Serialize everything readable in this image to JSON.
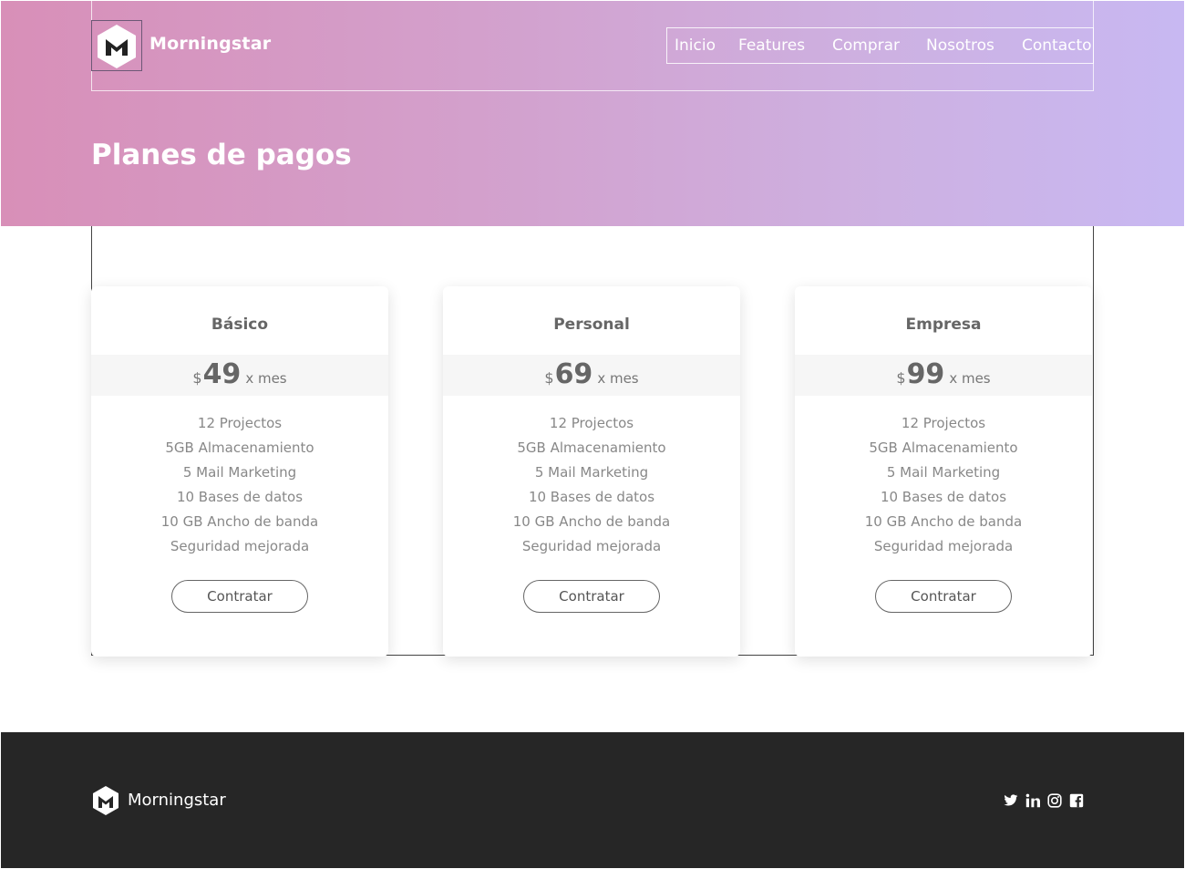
{
  "header": {
    "brand": "Morningstar",
    "nav": [
      "Inicio",
      "Features",
      "Comprar",
      "Nosotros",
      "Contacto"
    ]
  },
  "hero": {
    "title": "Planes de pagos"
  },
  "plans": [
    {
      "name": "Básico",
      "currency": "$",
      "price": "49",
      "period": "x mes",
      "features": [
        "12 Projectos",
        "5GB Almacenamiento",
        "5 Mail Marketing",
        "10 Bases de datos",
        "10 GB Ancho de banda",
        "Seguridad mejorada"
      ],
      "button": "Contratar"
    },
    {
      "name": "Personal",
      "currency": "$",
      "price": "69",
      "period": "x mes",
      "features": [
        "12 Projectos",
        "5GB Almacenamiento",
        "5 Mail Marketing",
        "10 Bases de datos",
        "10 GB Ancho de banda",
        "Seguridad mejorada"
      ],
      "button": "Contratar"
    },
    {
      "name": "Empresa",
      "currency": "$",
      "price": "99",
      "period": "x mes",
      "features": [
        "12 Projectos",
        "5GB Almacenamiento",
        "5 Mail Marketing",
        "10 Bases de datos",
        "10 GB Ancho de banda",
        "Seguridad mejorada"
      ],
      "button": "Contratar"
    }
  ],
  "footer": {
    "brand": "Morningstar",
    "social_icons": [
      "twitter-icon",
      "linkedin-icon",
      "instagram-icon",
      "facebook-icon"
    ]
  },
  "colors": {
    "hero_gradient_start": "#d88fb8",
    "hero_gradient_end": "#c8b8f2",
    "footer_bg": "#262626"
  }
}
